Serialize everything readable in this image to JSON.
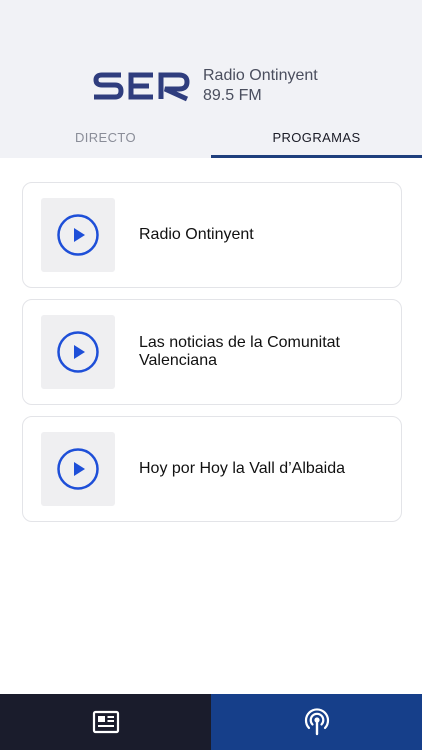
{
  "brand": {
    "logo_text": "SER",
    "station_name": "Radio Ontinyent",
    "frequency": "89.5 FM"
  },
  "tabs": [
    {
      "label": "DIRECTO",
      "active": false
    },
    {
      "label": "PROGRAMAS",
      "active": true
    }
  ],
  "programs": [
    {
      "title": "Radio Ontinyent",
      "icon": "play-icon"
    },
    {
      "title": "Las noticias de la Comunitat Valenciana",
      "icon": "play-icon"
    },
    {
      "title": "Hoy por Hoy la Vall d’Albaida",
      "icon": "play-icon"
    }
  ],
  "bottom_nav": [
    {
      "icon": "news-icon",
      "active": false
    },
    {
      "icon": "radio-broadcast-icon",
      "active": true
    }
  ],
  "colors": {
    "header_bg": "#f1f2f6",
    "accent_blue": "#1f3f7d",
    "play_blue": "#1e4fd8",
    "nav_dark": "#1a1c2c",
    "nav_active": "#163f8a"
  }
}
